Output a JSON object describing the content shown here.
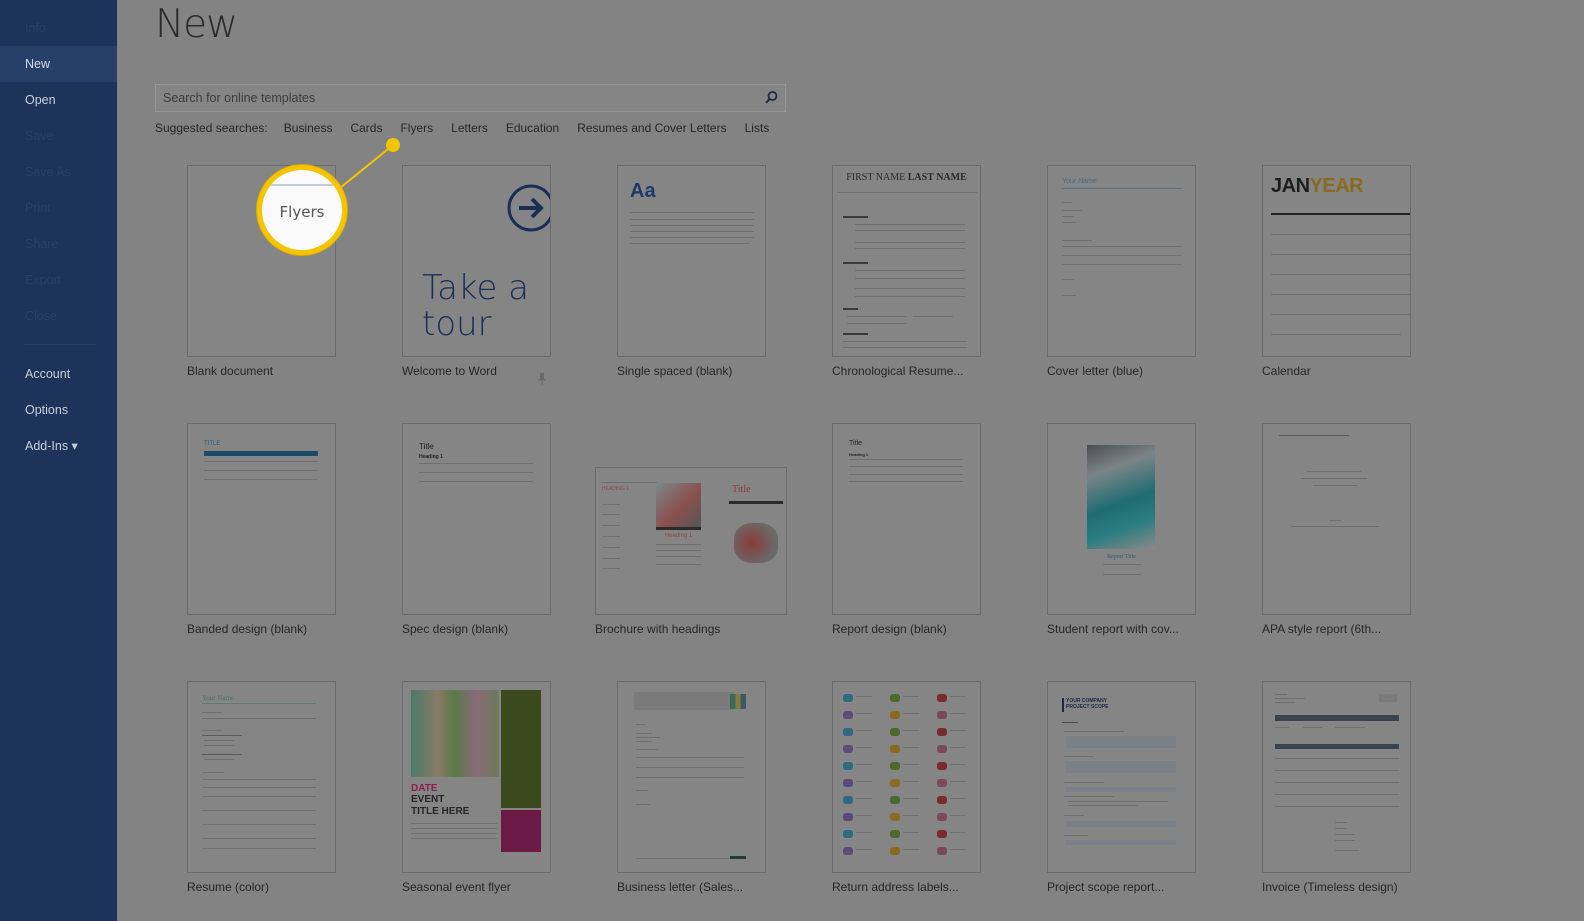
{
  "sidebar": {
    "items": [
      {
        "label": "Info",
        "state": "disabled"
      },
      {
        "label": "New",
        "state": "active"
      },
      {
        "label": "Open",
        "state": "normal"
      },
      {
        "label": "Save",
        "state": "disabled"
      },
      {
        "label": "Save As",
        "state": "disabled"
      },
      {
        "label": "Print",
        "state": "disabled"
      },
      {
        "label": "Share",
        "state": "disabled"
      },
      {
        "label": "Export",
        "state": "disabled"
      },
      {
        "label": "Close",
        "state": "disabled"
      }
    ],
    "bottom_items": [
      {
        "label": "Account"
      },
      {
        "label": "Options"
      },
      {
        "label": "Add-Ins ▾"
      }
    ]
  },
  "main": {
    "title": "New",
    "search": {
      "placeholder": "Search for online templates",
      "value": "",
      "icon": "search-icon"
    },
    "suggested": {
      "label": "Suggested searches:",
      "links": [
        "Business",
        "Cards",
        "Flyers",
        "Letters",
        "Education",
        "Resumes and Cover Letters",
        "Lists"
      ]
    },
    "templates": [
      {
        "name": "Blank document"
      },
      {
        "name": "Welcome to Word",
        "thumb_text": "Take a tour",
        "pinned": true
      },
      {
        "name": "Single spaced (blank)",
        "thumb_text": "Aa"
      },
      {
        "name": "Chronological Resume...",
        "thumb_text_first": "FIRST NAME ",
        "thumb_text_last": "LAST NAME"
      },
      {
        "name": "Cover letter (blue)",
        "thumb_text": "Your Name"
      },
      {
        "name": "Calendar",
        "thumb_text_month": "JAN",
        "thumb_text_year": "YEAR"
      },
      {
        "name": "Banded design (blank)",
        "thumb_text": "TITLE"
      },
      {
        "name": "Spec design (blank)",
        "thumb_text": "Title",
        "thumb_heading": "Heading 1"
      },
      {
        "name": "Brochure with headings",
        "thumb_text": "Title",
        "thumb_heading": "Heading 1"
      },
      {
        "name": "Report design (blank)",
        "thumb_text": "Title",
        "thumb_heading": "Heading 1"
      },
      {
        "name": "Student report with cov...",
        "thumb_text": "Report Title"
      },
      {
        "name": "APA style report (6th..."
      },
      {
        "name": "Resume (color)",
        "thumb_text": "Your Name"
      },
      {
        "name": "Seasonal event flyer",
        "thumb_date": "DATE",
        "thumb_title1": "EVENT",
        "thumb_title2": "TITLE HERE"
      },
      {
        "name": "Business letter (Sales..."
      },
      {
        "name": "Return address labels..."
      },
      {
        "name": "Project scope report...",
        "thumb_text1": "YOUR COMPANY",
        "thumb_text2": "PROJECT SCOPE"
      },
      {
        "name": "Invoice (Timeless design)"
      }
    ]
  },
  "callout": {
    "text": "Flyers",
    "color": "#f5c400"
  },
  "colors": {
    "sidebar": "#1d3359",
    "sidebar_active": "#27406a",
    "overlay_bg": "#838383",
    "accent_navy": "#1b3a6b"
  }
}
